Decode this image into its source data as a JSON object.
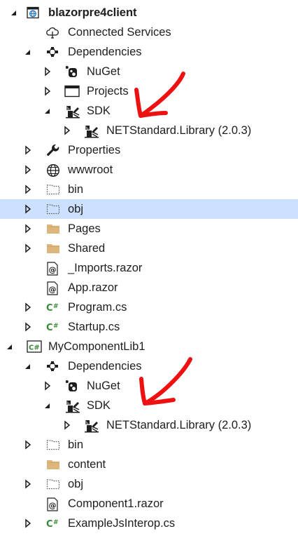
{
  "colors": {
    "selection": "#cce0ff",
    "text": "#1e1e1e",
    "annotation_arrow": "#ee1111",
    "csharp_icon": "#388a34",
    "folder_icon": "#dcb67a"
  },
  "tree": {
    "project1": {
      "name": "blazorpre4client",
      "connected_services": "Connected Services",
      "dependencies": "Dependencies",
      "nuget": "NuGet",
      "projects": "Projects",
      "sdk": "SDK",
      "netstandard": "NETStandard.Library (2.0.3)",
      "properties": "Properties",
      "wwwroot": "wwwroot",
      "bin": "bin",
      "obj": "obj",
      "pages": "Pages",
      "shared": "Shared",
      "imports": "_Imports.razor",
      "app": "App.razor",
      "program": "Program.cs",
      "startup": "Startup.cs"
    },
    "project2": {
      "name": "MyComponentLib1",
      "dependencies": "Dependencies",
      "nuget": "NuGet",
      "sdk": "SDK",
      "netstandard": "NETStandard.Library (2.0.3)",
      "bin": "bin",
      "content": "content",
      "obj": "obj",
      "component1": "Component1.razor",
      "examplejs": "ExampleJsInterop.cs"
    }
  },
  "selected_item": "obj"
}
